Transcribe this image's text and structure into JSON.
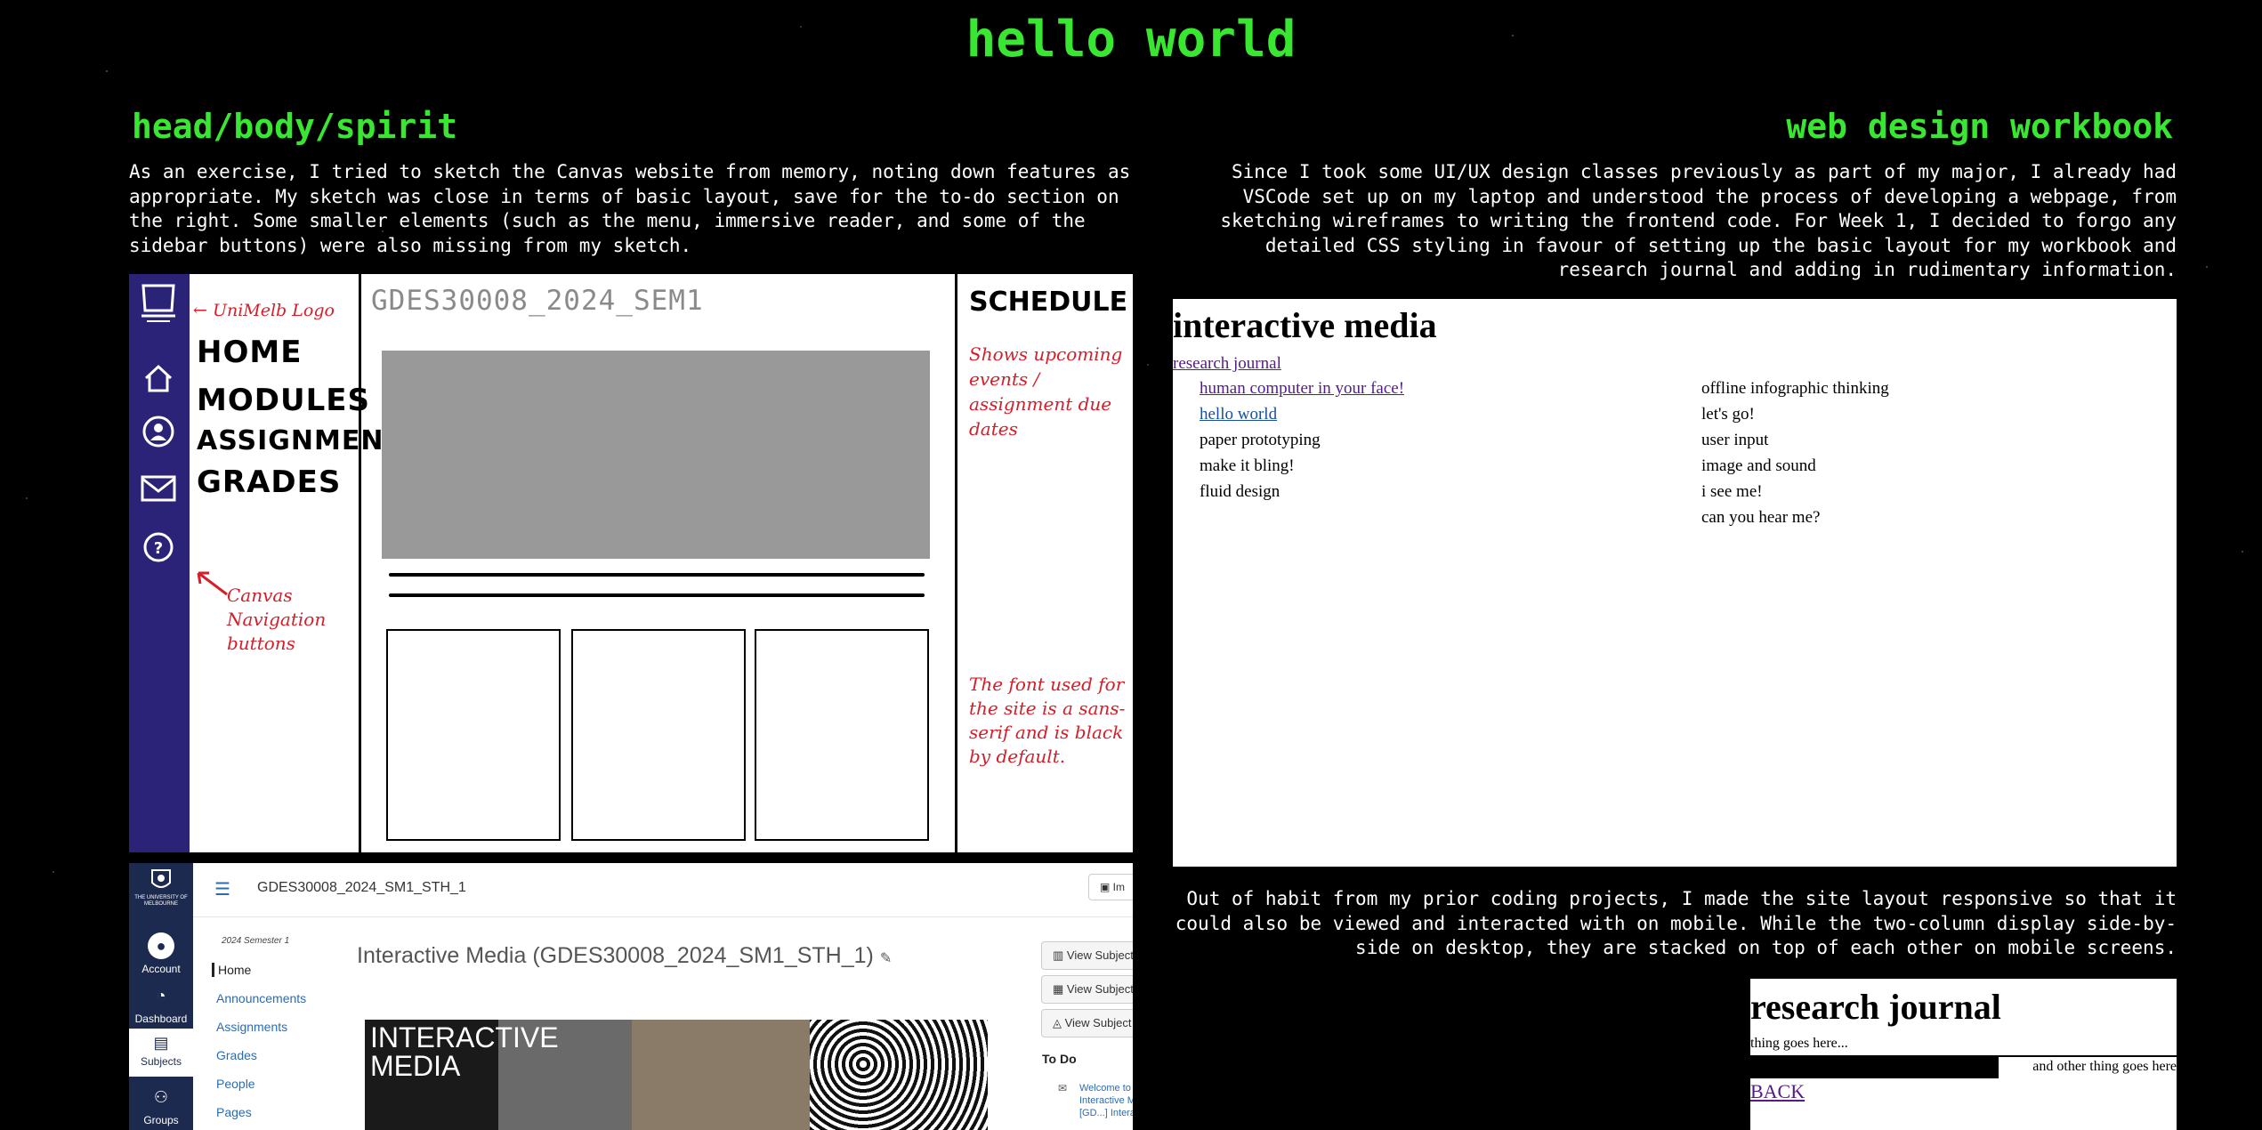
{
  "site": {
    "title": "hello world",
    "colors": {
      "accent": "#39e632",
      "background": "#000000"
    }
  },
  "left": {
    "heading": "head/body/spirit",
    "paragraph": "As an exercise, I tried to sketch the Canvas website from memory, noting down features as appropriate. My sketch was close in terms of basic layout, save for the to-do section on the right. Some smaller elements (such as the menu, immersive reader, and some of the sidebar buttons) were also missing from my sketch."
  },
  "sketch": {
    "course_code": "GDES30008_2024_SEM1",
    "nav": [
      "HOME",
      "MODULES",
      "ASSIGNMENTS",
      "GRADES"
    ],
    "schedule_heading": "SCHEDULE",
    "notes": {
      "logo": "← UniMelb Logo",
      "nav_buttons": "Canvas Navigation buttons",
      "schedule": "Shows upcoming events / assignment due dates",
      "font": "The font used for the site is a sans-serif and is black by default."
    },
    "icons": [
      "unimelb-logo-icon",
      "home-icon",
      "account-icon",
      "inbox-icon",
      "help-icon"
    ]
  },
  "canvas": {
    "logo_text": "THE UNIVERSITY OF MELBOURNE",
    "nav": [
      {
        "label": "Account",
        "icon": "account-icon"
      },
      {
        "label": "Dashboard",
        "icon": "dashboard-icon"
      },
      {
        "label": "Subjects",
        "icon": "subjects-icon"
      },
      {
        "label": "Groups",
        "icon": "groups-icon"
      }
    ],
    "breadcrumb": "GDES30008_2024_SM1_STH_1",
    "immersive_label": "Im",
    "semester": "2024 Semester 1",
    "menu": [
      "Home",
      "Announcements",
      "Assignments",
      "Grades",
      "People",
      "Pages"
    ],
    "title": "Interactive Media (GDES30008_2024_SM1_STH_1)",
    "banner_text": "INTERACTIVE MEDIA",
    "buttons": [
      "View Subject",
      "View Subject",
      "View Subject"
    ],
    "todo_heading": "To Do",
    "todo_item": "Welcome to Interactive Media [GD...] Interactive"
  },
  "right": {
    "heading": "web design workbook",
    "paragraph": "Since I took some UI/UX design classes previously as part of my major, I already had VSCode set up on my laptop and understood the process of developing a webpage, from sketching wireframes to writing the frontend code. For Week 1, I decided to forgo any detailed CSS styling in favour of setting up the basic layout for my workbook and research journal and adding in rudimentary information.",
    "paragraph2": "Out of habit from my prior coding projects, I made the site layout responsive so that it could also be viewed and interacted with on mobile. While the two-column display side-by-side on desktop, they are stacked on top of each other on mobile screens."
  },
  "interactive_media": {
    "title": "interactive media",
    "research_link": "research journal",
    "col1": [
      {
        "label": "human computer in your face!",
        "style": "visited"
      },
      {
        "label": "hello world",
        "style": "link"
      },
      {
        "label": "paper prototyping",
        "style": "text"
      },
      {
        "label": "make it bling!",
        "style": "text"
      },
      {
        "label": "fluid design",
        "style": "text"
      }
    ],
    "col2": [
      {
        "label": "offline infographic thinking",
        "style": "text"
      },
      {
        "label": "let's go!",
        "style": "text"
      },
      {
        "label": "user input",
        "style": "text"
      },
      {
        "label": "image and sound",
        "style": "text"
      },
      {
        "label": "i see me!",
        "style": "text"
      },
      {
        "label": "can you hear me?",
        "style": "text"
      }
    ]
  },
  "research_journal": {
    "title": "research journal",
    "thing1": "thing goes here...",
    "thing2": "and other thing goes here",
    "back": "BACK"
  }
}
